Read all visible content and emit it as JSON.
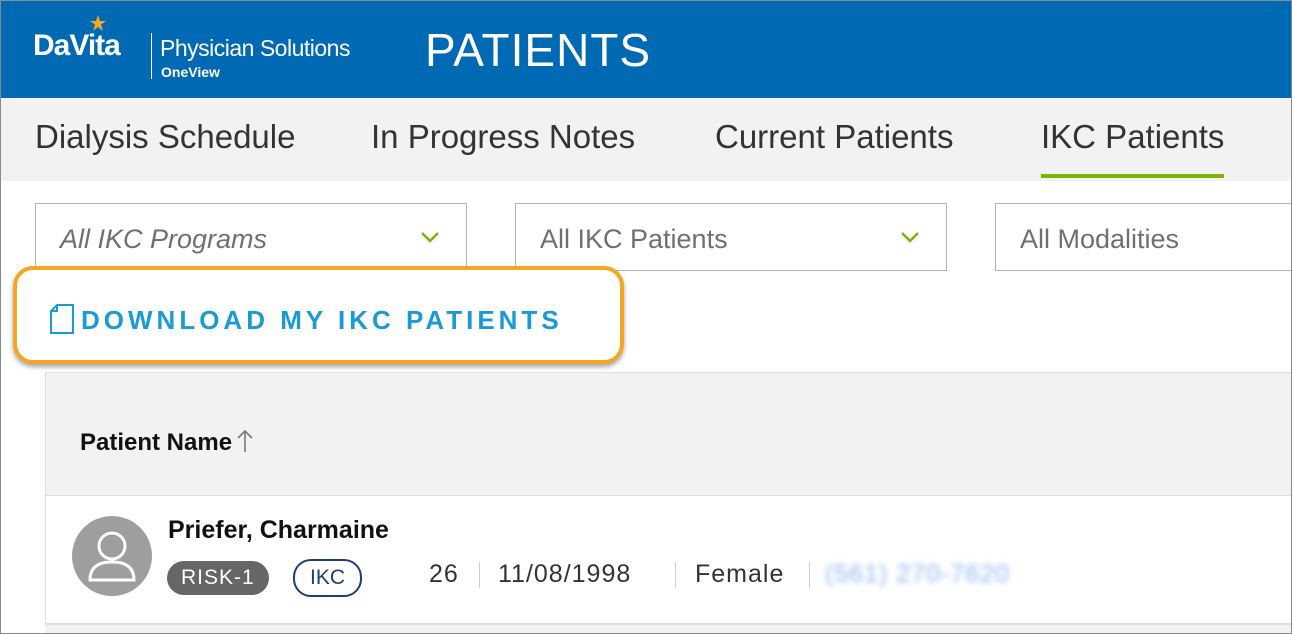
{
  "header": {
    "logo_word": "DaVita",
    "logo_tagline": "Physician Solutions",
    "logo_sub": "OneView",
    "page_title": "PATIENTS"
  },
  "tabs": [
    {
      "label": "Dialysis Schedule",
      "active": false
    },
    {
      "label": "In Progress Notes",
      "active": false
    },
    {
      "label": "Current Patients",
      "active": false
    },
    {
      "label": "IKC Patients",
      "active": true
    }
  ],
  "filters": {
    "programs": {
      "value": "All IKC Programs"
    },
    "patients": {
      "value": "All IKC Patients"
    },
    "modalities": {
      "value": "All Modalities"
    }
  },
  "download": {
    "label": "DOWNLOAD MY IKC PATIENTS",
    "icon": "document-icon"
  },
  "table": {
    "columns": [
      {
        "label": "Patient Name",
        "sort": "ascending"
      }
    ],
    "rows": [
      {
        "name": "Priefer, Charmaine",
        "risk_badge": "RISK-1",
        "program_badge": "IKC",
        "age": "26",
        "dob": "11/08/1998",
        "gender": "Female",
        "phone": "(561) 270-7620"
      }
    ]
  },
  "colors": {
    "header_bg": "#0069b4",
    "active_tab_underline": "#7ab800",
    "download_text": "#1a9ad6",
    "highlight_border": "#f5a623",
    "chevron": "#7ab800"
  }
}
